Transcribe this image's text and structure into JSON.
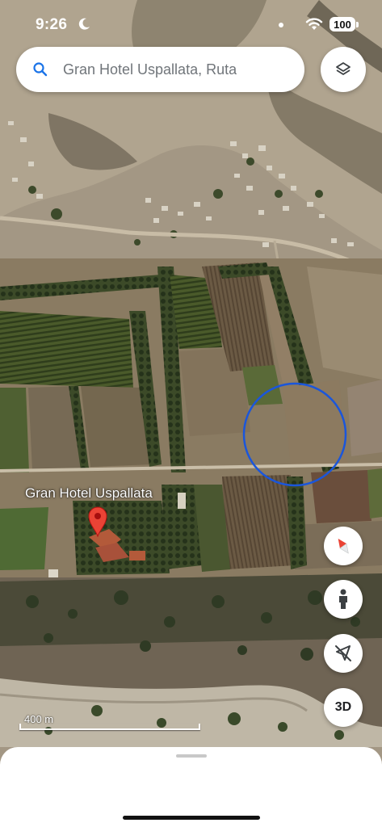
{
  "status_bar": {
    "time": "9:26",
    "battery": "100",
    "icons": [
      "moon-icon",
      "wifi-icon",
      "battery-icon"
    ]
  },
  "search": {
    "value": "Gran Hotel Uspallata, Ruta"
  },
  "map": {
    "view": "satellite",
    "place_label": "Gran Hotel Uspallata",
    "scale_label": "400 m",
    "accuracy_circle_color": "#1a56db",
    "pin_color": "#ea4335"
  },
  "controls": {
    "three_d_label": "3D",
    "icons": [
      "layers-icon",
      "compass-icon",
      "street-view-person-icon",
      "location-off-icon"
    ]
  }
}
